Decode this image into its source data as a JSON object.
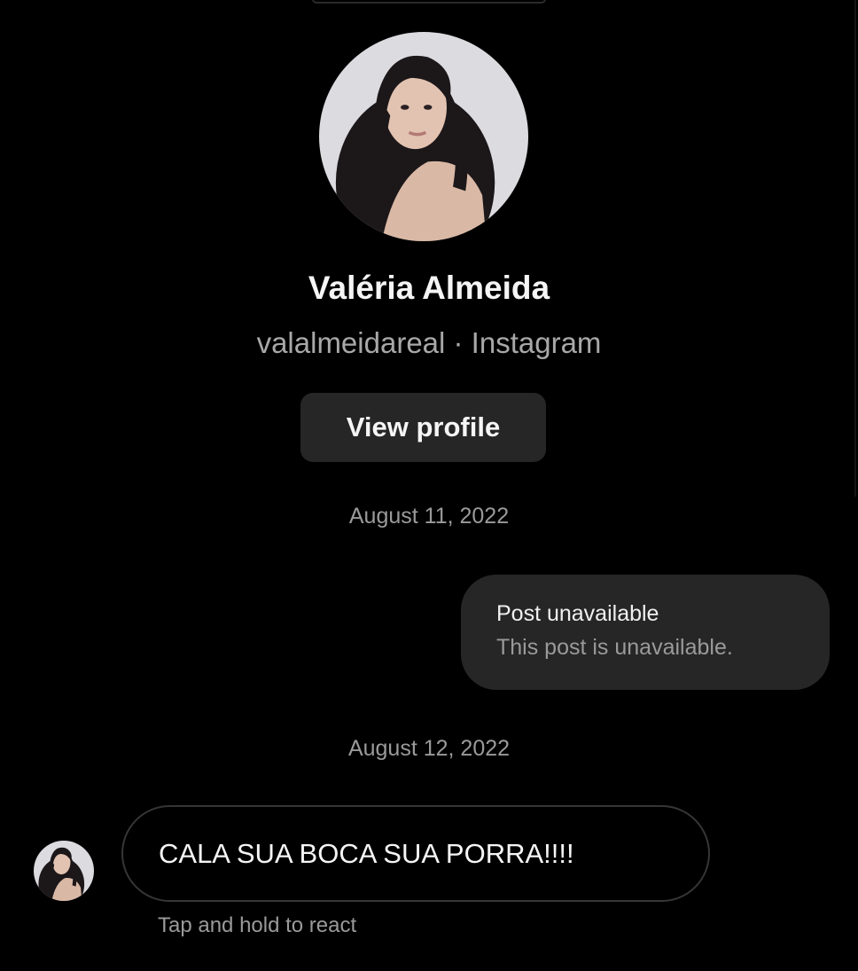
{
  "profile": {
    "name": "Valéria Almeida",
    "subtitle": "valalmeidareal · Instagram",
    "view_profile_label": "View profile"
  },
  "thread": {
    "date_1": "August 11, 2022",
    "shared_post": {
      "title": "Post unavailable",
      "text": "This post is unavailable."
    },
    "date_2": "August 12, 2022",
    "incoming_message": "CALA SUA BOCA SUA PORRA!!!!",
    "react_hint": "Tap and hold to react"
  },
  "icons": {
    "large_avatar": "profile-photo",
    "small_avatar": "sender-avatar"
  },
  "colors": {
    "background": "#000000",
    "bubble": "#262626",
    "secondary_text": "#a8a8a8"
  }
}
